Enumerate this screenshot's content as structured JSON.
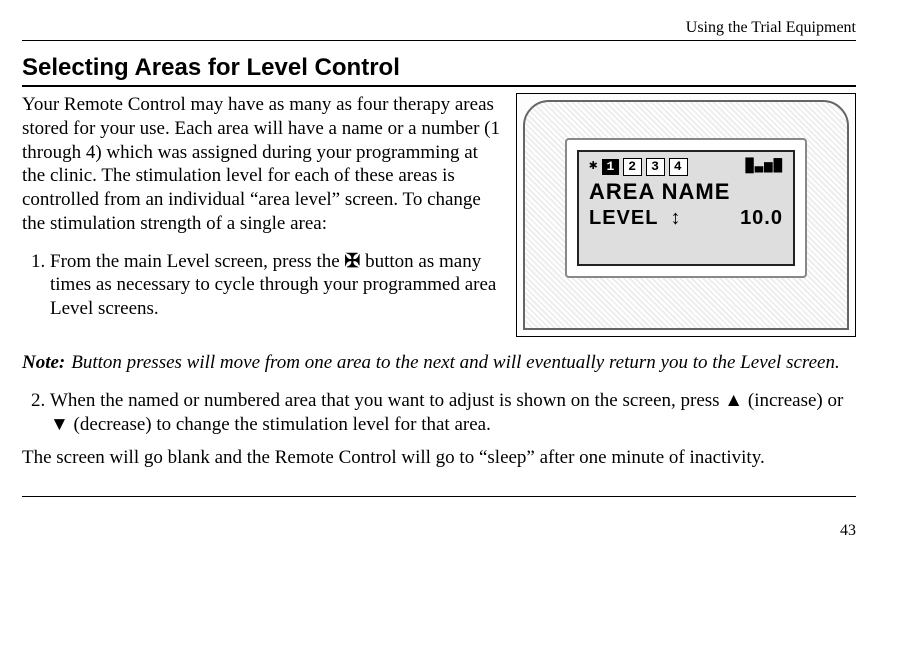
{
  "running_head": "Using the Trial Equipment",
  "heading": "Selecting Areas for Level Control",
  "intro": "Your Remote Control may have as many as four therapy areas stored for your use. Each area will have a name or a number (1 through 4) which was assigned during your programming at the clinic. The stimulation level for each of these areas is controlled from an individual “area level” screen. To change the stimulation strength of a single area:",
  "step1_a": "From the main Level screen, press the ",
  "step1_b": " button as many times as necessary to cycle through your programmed area Level screens.",
  "area_button_glyph": "✠",
  "note_label": "Note:",
  "note_body": "Button presses will move from one area to the next and will eventually return you to the Level screen.",
  "step2": "When the named or numbered area that you want to adjust is shown on the screen, press ▲ (increase) or ▼ (decrease) to change the stimulation level for that area.",
  "after": "The screen will go blank and the Remote Control will go to “sleep” after one minute of inactivity.",
  "page_number": "43",
  "lcd": {
    "tab1": "1",
    "tab2": "2",
    "tab3": "3",
    "tab4": "4",
    "area_label": "AREA NAME",
    "level_label": "LEVEL",
    "updown": "↕",
    "level_value": "10.0",
    "signal": "█▃▅▇"
  }
}
